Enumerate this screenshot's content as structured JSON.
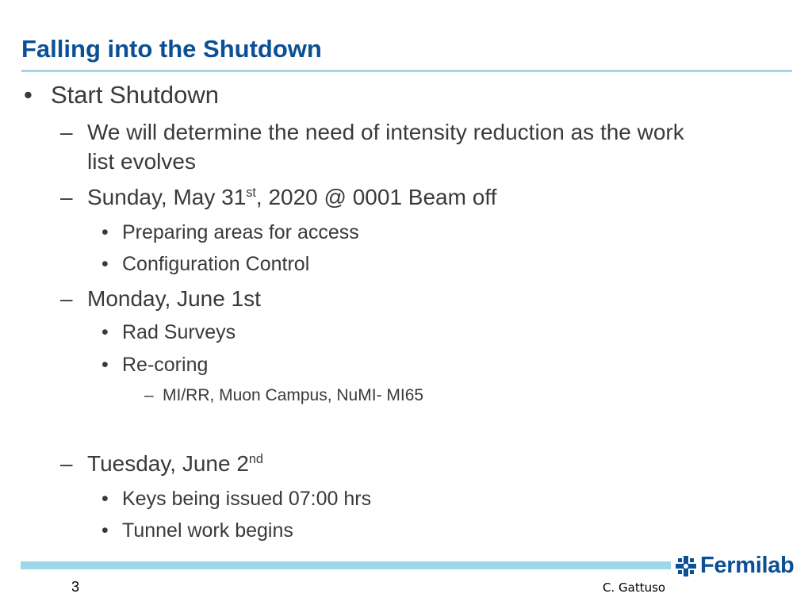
{
  "slide": {
    "title": "Falling into the Shutdown",
    "bullets": {
      "b1": "Start Shutdown",
      "b1_1": "We will determine the need of intensity reduction as the work",
      "b1_1_cont": "list evolves",
      "b1_2_pre": "Sunday, May 31",
      "b1_2_sup": "st",
      "b1_2_post": ", 2020 @ 0001 Beam off",
      "b1_2_1": "Preparing areas for access",
      "b1_2_2": "Configuration Control",
      "b1_3": "Monday, June 1st",
      "b1_3_1": "Rad Surveys",
      "b1_3_2": "Re-coring",
      "b1_3_2_1": "MI/RR, Muon Campus, NuMI- MI65",
      "b1_4_pre": "Tuesday, June 2",
      "b1_4_sup": "nd",
      "b1_4_1": "Keys being issued  07:00 hrs",
      "b1_4_2": "Tunnel work begins"
    },
    "markers": {
      "bullet": "•",
      "dash": "–"
    }
  },
  "footer": {
    "page_number": "3",
    "author": "C. Gattuso",
    "logo_text": "Fermilab",
    "logo_icon": "fermilab-logo-icon"
  },
  "colors": {
    "title": "#0b4f95",
    "rule": "#a6d5e6",
    "footer_bar": "#9ed7e7"
  }
}
